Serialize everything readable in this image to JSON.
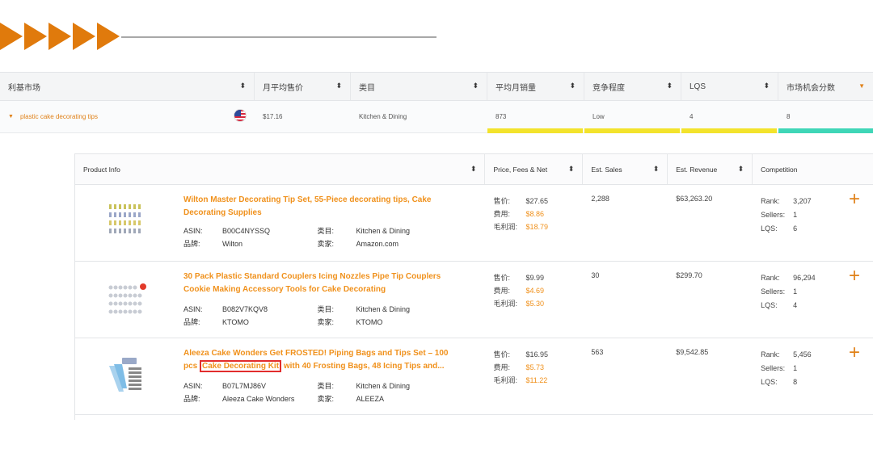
{
  "colors": {
    "accent": "#e0821a",
    "title_orange": "#f0911c",
    "yellow_bar": "#f3e32c",
    "green_bar": "#3fd6b7",
    "highlight_red": "#e22d2d"
  },
  "market": {
    "headers": [
      "利基市场",
      "月平均售价",
      "类目",
      "平均月销量",
      "竞争程度",
      "LQS",
      "市场机会分数"
    ],
    "row": {
      "keyword": "plastic cake decorating tips",
      "flag_icon": "us-flag-icon",
      "avg_price": "$17.16",
      "category": "Kitchen & Dining",
      "avg_monthly_sales": "873",
      "competition": "Low",
      "lqs": "4",
      "opportunity_score": "8"
    }
  },
  "products": {
    "headers": [
      "Product Info",
      "Price, Fees & Net",
      "Est. Sales",
      "Est. Revenue",
      "Competition"
    ],
    "labels": {
      "asin": "ASIN:",
      "brand": "品牌:",
      "category": "类目:",
      "seller": "卖家:",
      "price": "售价:",
      "fees": "费用:",
      "net": "毛利润:",
      "rank": "Rank:",
      "sellers": "Sellers:",
      "lqs": "LQS:"
    },
    "rows": [
      {
        "title": "Wilton Master Decorating Tip Set, 55-Piece decorating tips, Cake Decorating Supplies",
        "asin": "B00C4NYSSQ",
        "brand": "Wilton",
        "category": "Kitchen & Dining",
        "seller": "Amazon.com",
        "price": "$27.65",
        "fees": "$8.86",
        "net": "$18.79",
        "sales": "2,288",
        "revenue": "$63,263.20",
        "rank": "3,207",
        "sellers": "1",
        "lqs": "6"
      },
      {
        "title": "30 Pack Plastic Standard Couplers Icing Nozzles Pipe Tip Couplers Cookie Making Accessory Tools for Cake Decorating",
        "asin": "B082V7KQV8",
        "brand": "KTOMO",
        "category": "Kitchen & Dining",
        "seller": "KTOMO",
        "price": "$9.99",
        "fees": "$4.69",
        "net": "$5.30",
        "sales": "30",
        "revenue": "$299.70",
        "rank": "96,294",
        "sellers": "1",
        "lqs": "4"
      },
      {
        "title_pre": "Aleeza Cake Wonders Get FROSTED! Piping Bags and Tips Set – 100 pcs ",
        "title_hl": "Cake Decorating Kit",
        "title_post": " with 40 Frosting Bags, 48 Icing Tips and...",
        "asin": "B07L7MJ86V",
        "brand": "Aleeza Cake Wonders",
        "category": "Kitchen & Dining",
        "seller": "ALEEZA",
        "price": "$16.95",
        "fees": "$5.73",
        "net": "$11.22",
        "sales": "563",
        "revenue": "$9,542.85",
        "rank": "5,456",
        "sellers": "1",
        "lqs": "8"
      }
    ],
    "add_icon": "plus-icon"
  }
}
